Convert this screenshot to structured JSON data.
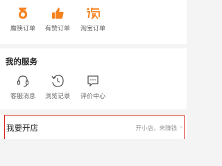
{
  "orders": {
    "items": [
      {
        "label": "魔筷订单",
        "icon": "mokuai-logo-icon"
      },
      {
        "label": "有赞订单",
        "icon": "youzan-thumbs-up-icon"
      },
      {
        "label": "淘宝订单",
        "icon": "taobao-logo-icon"
      }
    ]
  },
  "services": {
    "title": "我的服务",
    "items": [
      {
        "label": "客服消息",
        "icon": "headset-icon"
      },
      {
        "label": "浏览记录",
        "icon": "history-icon"
      },
      {
        "label": "评价中心",
        "icon": "comment-icon"
      }
    ]
  },
  "shop": {
    "title": "我要开店",
    "subtitle": "开小店，来赚钱",
    "chevron": "›"
  },
  "colors": {
    "accent": "#f5821f",
    "highlight_border": "#d8281f",
    "background": "#f4f4f4"
  }
}
